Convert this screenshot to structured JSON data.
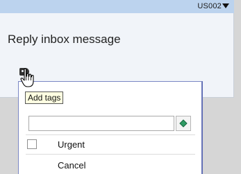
{
  "card": {
    "story_id": "US002",
    "title": "Reply inbox message"
  },
  "tooltip": {
    "text": "Add tags"
  },
  "tag_popup": {
    "input_value": "",
    "options": [
      {
        "label": "Urgent",
        "checked": false
      }
    ],
    "cancel_label": "Cancel"
  },
  "icons": {
    "tag": "tag-icon",
    "cursor": "hand-pointer-icon",
    "dropdown": "caret-down-icon",
    "add_tag": "add-tag-icon"
  },
  "colors": {
    "card_header": "#bcd3ee",
    "card_body": "#f1f4f9",
    "popup_border": "#6471b6",
    "tooltip_bg": "#ffffe1",
    "add_icon": "#2e9a64"
  }
}
